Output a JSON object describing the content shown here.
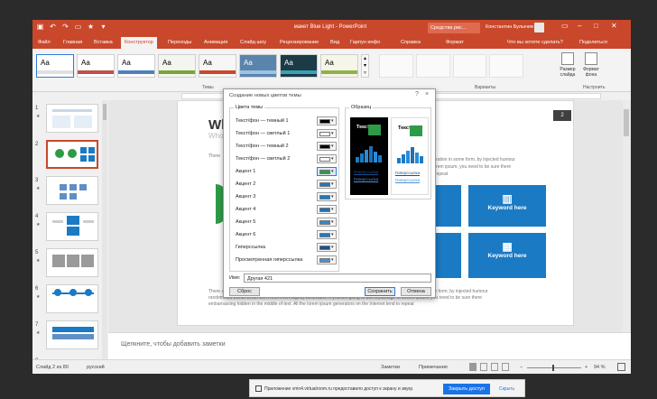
{
  "colors": {
    "accent": "#c9482b",
    "tile_blue": "#1b7ac4",
    "green": "#2e9b47"
  },
  "titlebar": {
    "doc_title": "макет Blue Light  -  PowerPoint",
    "search_label": "Средства рис...",
    "user_name": "Константин Булычев",
    "icons": [
      "save-icon",
      "undo-icon",
      "redo-icon",
      "slideshow-icon",
      "customize-icon"
    ],
    "window_controls": [
      "ribbon-options-icon",
      "minimize-icon",
      "maximize-icon",
      "close-icon"
    ]
  },
  "tabs": [
    {
      "label": "Файл"
    },
    {
      "label": "Главная"
    },
    {
      "label": "Вставка"
    },
    {
      "label": "Конструктор",
      "active": true
    },
    {
      "label": "Переходы"
    },
    {
      "label": "Анимация"
    },
    {
      "label": "Слайд-шоу"
    },
    {
      "label": "Рецензирование"
    },
    {
      "label": "Вид"
    },
    {
      "label": "Гарпун инфо"
    },
    {
      "label": "Справка"
    },
    {
      "label": "Формат"
    }
  ],
  "tell_me": "Что вы хотите сделать?",
  "share": "Поделиться",
  "ribbon": {
    "theme_label": "Aa",
    "group_themes": "Темы",
    "group_variants": "Варианты",
    "group_customize": "Настроить",
    "btn_slide_size": "Размер слайда",
    "btn_format_bg": "Формат фона"
  },
  "thumbnails": [
    {
      "num": "1",
      "star": "★"
    },
    {
      "num": "2",
      "star": ""
    },
    {
      "num": "3",
      "star": "★"
    },
    {
      "num": "4",
      "star": "★"
    },
    {
      "num": "5",
      "star": "★"
    },
    {
      "num": "6",
      "star": "★"
    },
    {
      "num": "7",
      "star": "★"
    }
  ],
  "slide": {
    "title": "Wh",
    "subtitle": "Who",
    "text_left_top": "There",
    "text_right_1": "alteration in some form, by injected humour",
    "text_right_2": "d lorem ipsum, you need to be sure there",
    "text_right_3": "ne repeat",
    "text_bottom_1": "There are many variations of passages of Lorem Ipsum available, but the majority have suffered alteration in some form, by injected humour",
    "text_bottom_2": "randomised words which don't look even slightly believable. If you are going to use a passage of Lorem Ipsum, you need to be sure there",
    "text_bottom_3": "embarrassing hidden in the middle of text. All the lorem ipsum generators on the Internet tend to repeat",
    "tile_label": "Keyword here",
    "slide_number": "2"
  },
  "dialog": {
    "title": "Создание новых цветов темы",
    "help": "?",
    "close": "×",
    "group_title": "Цвета темы",
    "sample_title": "Образец",
    "rows": [
      {
        "label": "Текст/фон — темный 1",
        "color": "#000000"
      },
      {
        "label": "Текст/фон — светлый 1",
        "color": "#ffffff"
      },
      {
        "label": "Текст/фон — темный 2",
        "color": "#000000"
      },
      {
        "label": "Текст/фон — светлый 2",
        "color": "#ffffff"
      },
      {
        "label": "Акцент 1",
        "color": "#2e9b47"
      },
      {
        "label": "Акцент 2",
        "color": "#1b7ac4"
      },
      {
        "label": "Акцент 3",
        "color": "#1b7ac4"
      },
      {
        "label": "Акцент 4",
        "color": "#1f6fb5"
      },
      {
        "label": "Акцент 5",
        "color": "#2a8ad6"
      },
      {
        "label": "Акцент 6",
        "color": "#1b7ac4"
      },
      {
        "label": "Гиперссылка",
        "color": "#1a4f8c"
      },
      {
        "label": "Просмотренная гиперссылка",
        "color": "#4a90d9"
      }
    ],
    "sample_text": "Текст",
    "sample_link": "Гиперссылка",
    "name_label": "Имя:",
    "name_value": "Другая 421",
    "btn_reset": "Сброс",
    "btn_save": "Сохранить",
    "btn_cancel": "Отмена"
  },
  "notes_placeholder": "Щелкните, чтобы добавить заметки",
  "status": {
    "slide_info": "Слайд 2 из 80",
    "language": "русский",
    "notes": "Заметки",
    "comments": "Примечания",
    "zoom": "94 %"
  },
  "notification": {
    "message": "Приложение vmn4.virtualroom.ru предоставило доступ к экрану и звуку.",
    "share_button": "Закрыть доступ",
    "hide_button": "Скрыть"
  }
}
